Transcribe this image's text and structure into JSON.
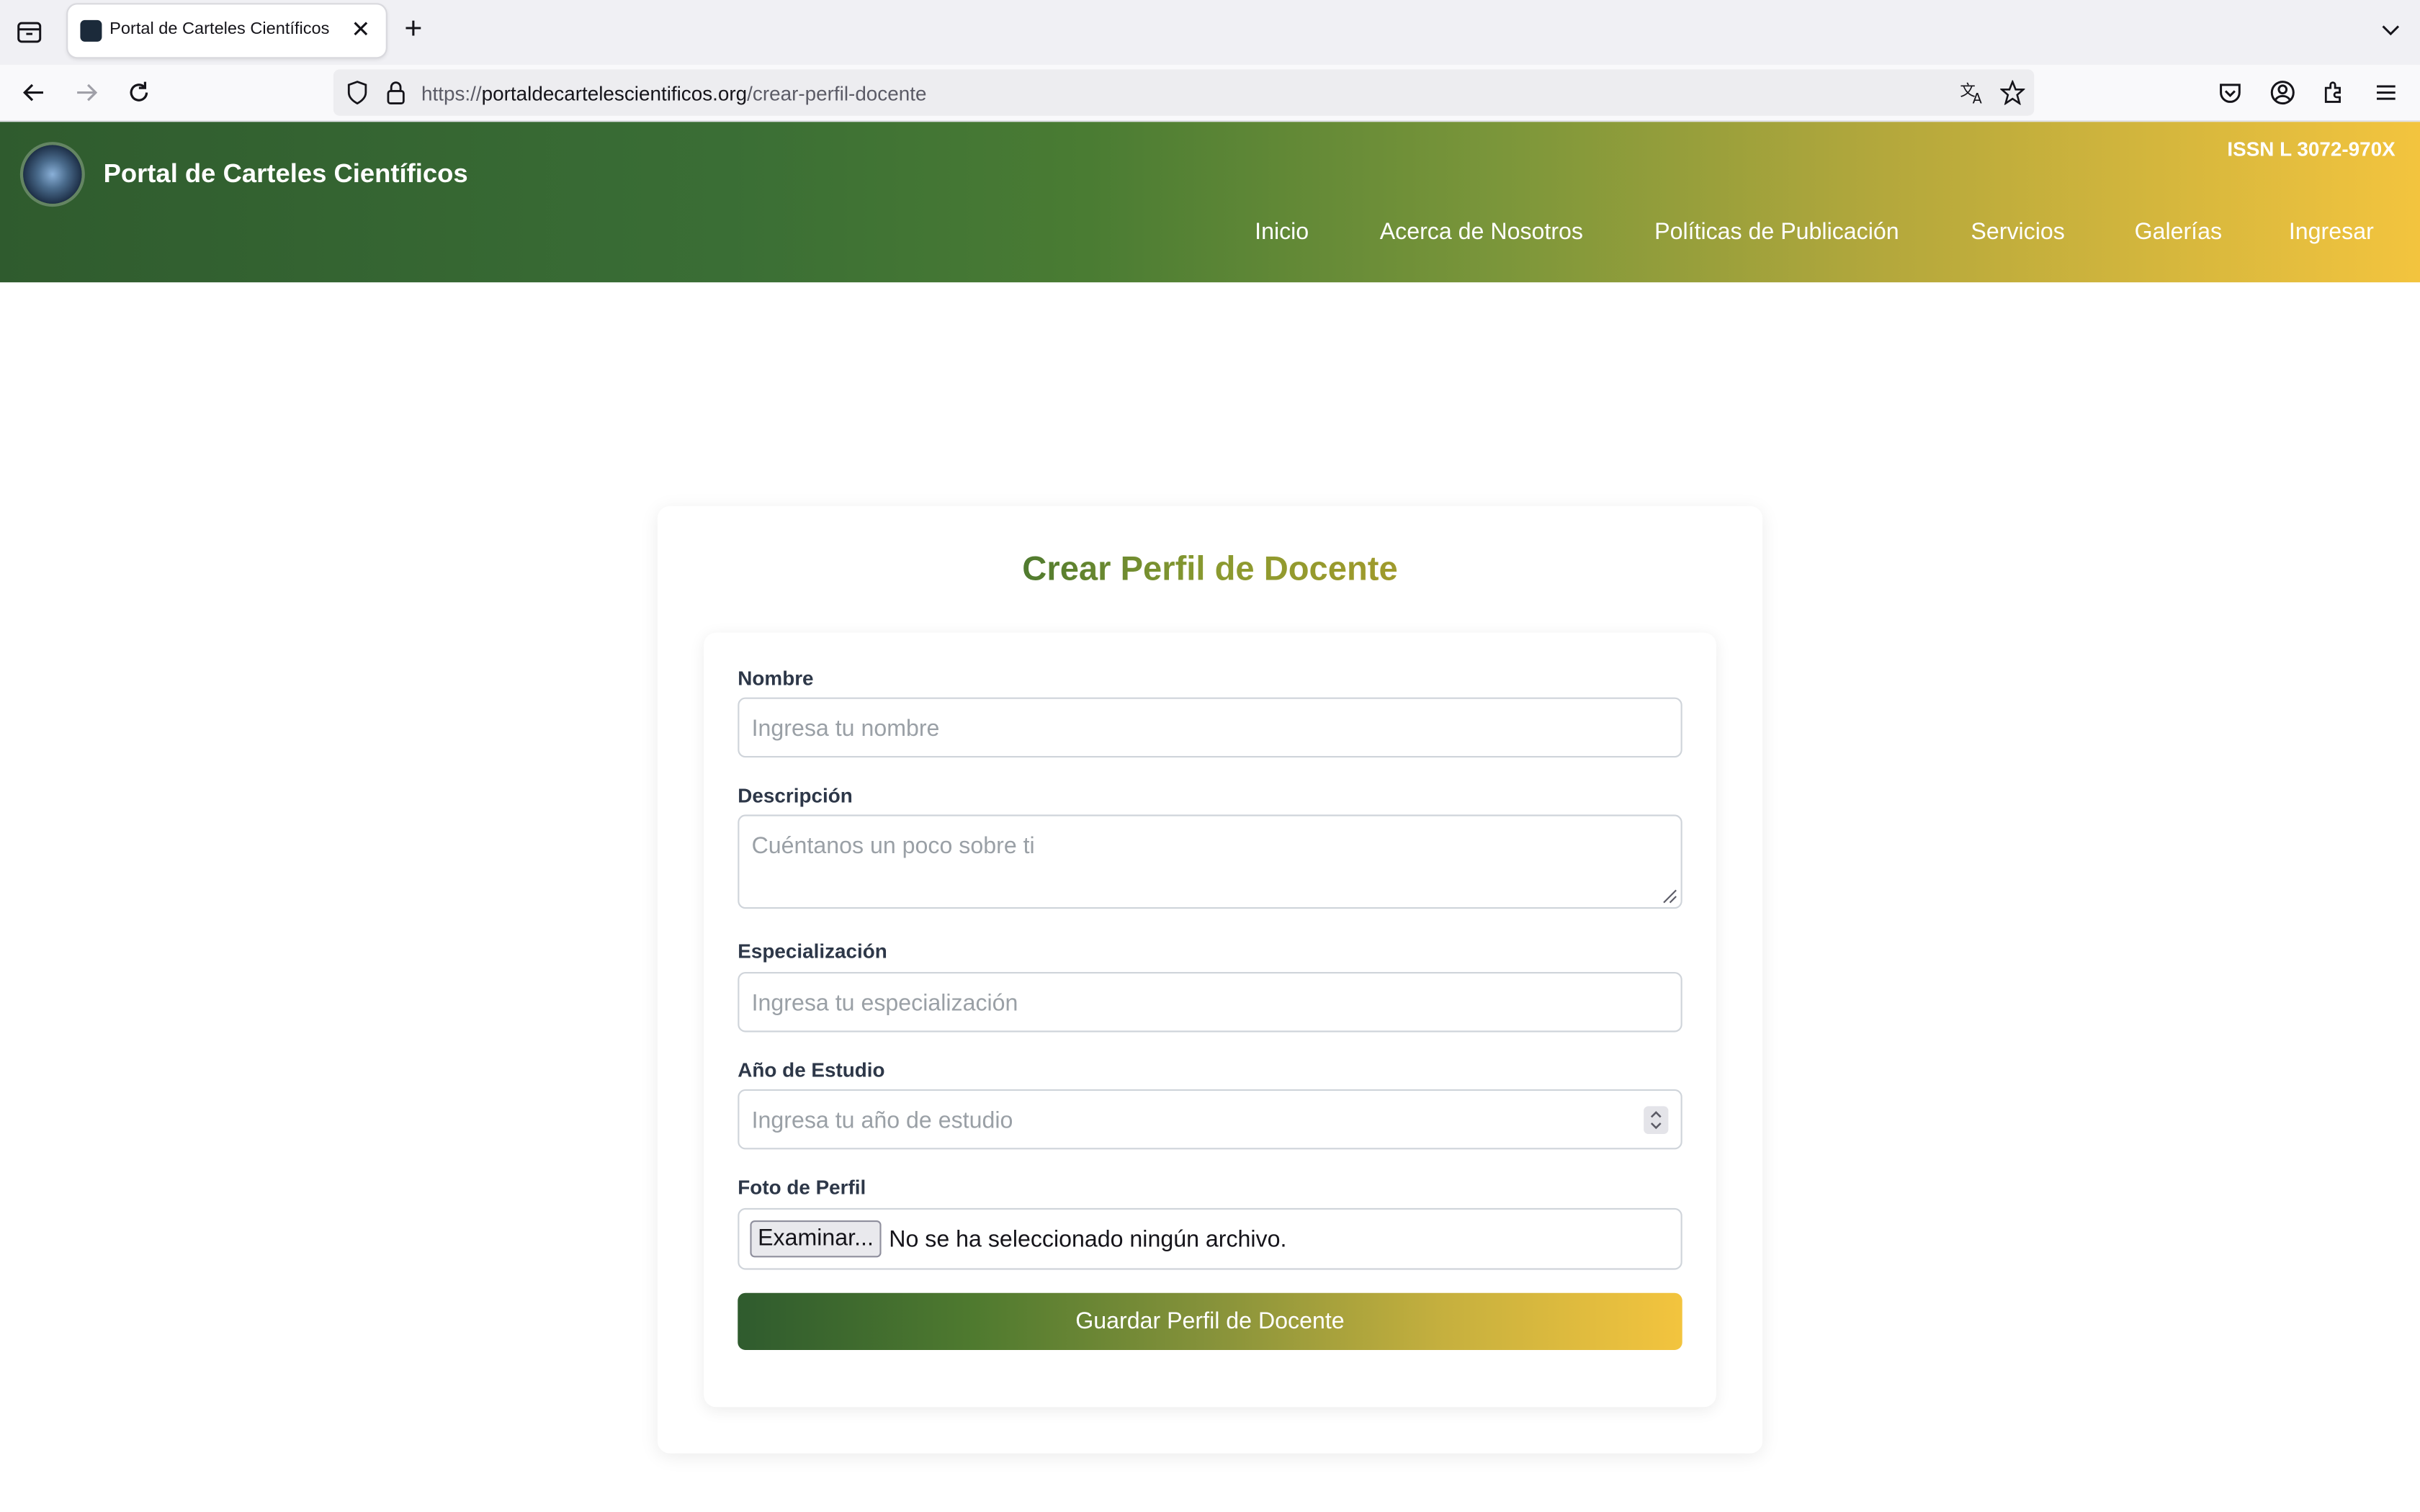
{
  "browser": {
    "tab_title": "Portal de Carteles Científicos",
    "url_prefix": "https://",
    "url_domain": "portaldecartelescientificos.org",
    "url_path": "/crear-perfil-docente"
  },
  "header": {
    "site_title": "Portal de Carteles Científicos",
    "issn": "ISSN L 3072-970X",
    "nav": [
      "Inicio",
      "Acerca de Nosotros",
      "Políticas de Publicación",
      "Servicios",
      "Galerías",
      "Ingresar"
    ]
  },
  "form": {
    "title": "Crear Perfil de Docente",
    "name_label": "Nombre",
    "name_placeholder": "Ingresa tu nombre",
    "desc_label": "Descripción",
    "desc_placeholder": "Cuéntanos un poco sobre ti",
    "spec_label": "Especialización",
    "spec_placeholder": "Ingresa tu especialización",
    "year_label": "Año de Estudio",
    "year_placeholder": "Ingresa tu año de estudio",
    "photo_label": "Foto de Perfil",
    "browse_label": "Examinar...",
    "no_file_text": "No se ha seleccionado ningún archivo.",
    "submit_label": "Guardar Perfil de Docente"
  },
  "colors": {
    "header_start": "#2f5b2e",
    "header_end": "#f3c43e"
  }
}
